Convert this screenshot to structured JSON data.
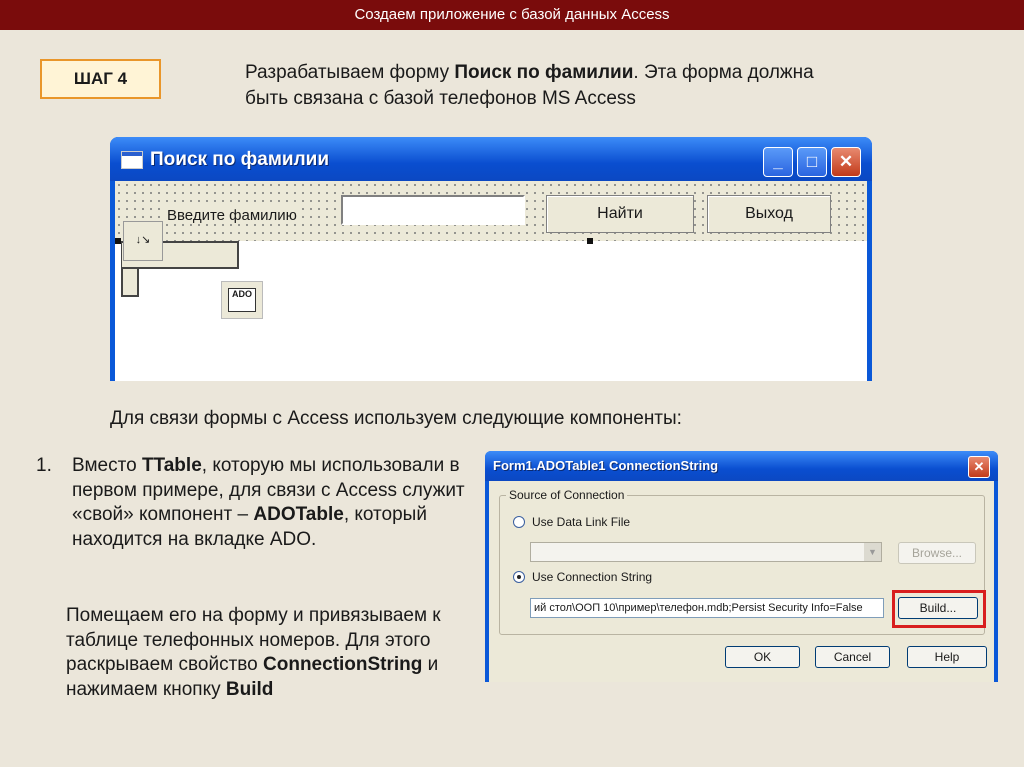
{
  "header": {
    "title": "Создаем приложение с базой данных Access"
  },
  "step": {
    "label": "ШАГ 4"
  },
  "intro": {
    "text1": "Разрабатываем форму ",
    "bold": "Поиск по фамилии",
    "text2": ". Эта форма должна",
    "line2": "быть связана с базой телефонов MS Access"
  },
  "form_window": {
    "title": "Поиск по фамилии",
    "label": "Введите фамилию",
    "edit_value": "",
    "find_button": "Найти",
    "exit_button": "Выход",
    "minimize": "_",
    "maximize": "□",
    "close": "✕",
    "ado_icon_text": "ADO"
  },
  "subheading": "Для связи формы с Access используем следующие компоненты:",
  "list": {
    "number": "1.",
    "p1_a": "Вместо ",
    "p1_b": "TTable",
    "p1_c": ", которую мы использовали в первом примере, для связи с Access служит «свой» компонент – ",
    "p1_d": "ADOTable",
    "p1_e": ", который находится на вкладке ADO.",
    "p2_a": "Помещаем его на форму и привязываем к таблице телефонных номеров. Для этого раскрываем свойство ",
    "p2_b": "ConnectionString",
    "p2_c": " и нажимаем кнопку ",
    "p2_d": "Build"
  },
  "dialog": {
    "title": "Form1.ADOTable1 ConnectionString",
    "close": "✕",
    "group_caption": "Source of Connection",
    "radio1_label": "Use Data Link File",
    "radio2_label": "Use Connection String",
    "browse_button": "Browse...",
    "connection_string": "ий стол\\ООП 10\\пример\\телефон.mdb;Persist Security Info=False",
    "build_button": "Build...",
    "ok_button": "OK",
    "cancel_button": "Cancel",
    "help_button": "Help"
  },
  "colors": {
    "header_bg": "#7a0c0c",
    "step_border": "#e9962a",
    "highlight": "#d81e1e"
  }
}
